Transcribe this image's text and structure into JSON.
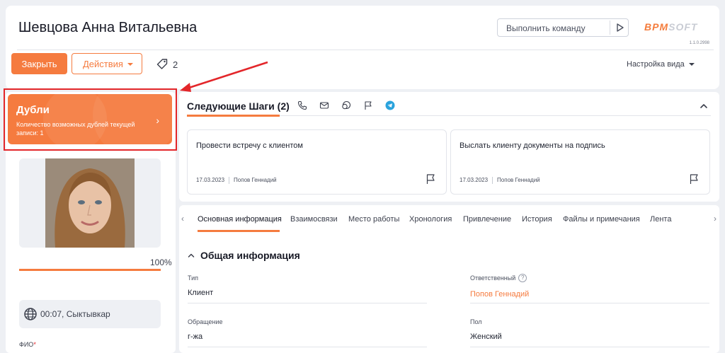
{
  "header": {
    "title": "Шевцова Анна Витальевна",
    "command_placeholder": "Выполнить команду",
    "logo_main": "BPM",
    "logo_accent": "SOFT",
    "version": "1.1.0.2998"
  },
  "toolbar": {
    "close_label": "Закрыть",
    "actions_label": "Действия",
    "tag_count": "2",
    "view_settings_label": "Настройка вида"
  },
  "duplicates": {
    "title": "Дубли",
    "description": "Количество возможных дублей текущей записи: 1"
  },
  "profile": {
    "completeness_label": "100%",
    "completeness_value": 1.0,
    "time_location": "00:07, Сыктывкар",
    "fio_label": "ФИО",
    "fio_required_mark": "*"
  },
  "next_steps": {
    "title": "Следующие Шаги (2)",
    "icons": [
      "phone-icon",
      "mail-icon",
      "chat-icon",
      "flag-icon",
      "telegram-icon"
    ],
    "cards": [
      {
        "text": "Провести встречу с клиентом",
        "date": "17.03.2023",
        "owner": "Попов Геннадий"
      },
      {
        "text": "Выслать клиенту документы на подпись",
        "date": "17.03.2023",
        "owner": "Попов Геннадий"
      }
    ]
  },
  "tabs": {
    "items": [
      "Основная информация",
      "Взаимосвязи",
      "Место работы",
      "Хронология",
      "Привлечение",
      "История",
      "Файлы и примечания",
      "Лента"
    ],
    "active_index": 0
  },
  "general_info": {
    "title": "Общая информация",
    "fields": {
      "type_label": "Тип",
      "type_value": "Клиент",
      "owner_label": "Ответственный",
      "owner_value": "Попов Геннадий",
      "salutation_label": "Обращение",
      "salutation_value": "г-жа",
      "gender_label": "Пол",
      "gender_value": "Женский"
    }
  },
  "colors": {
    "accent": "#f57b3f",
    "highlight": "#e3262a",
    "background": "#eef0f4"
  }
}
